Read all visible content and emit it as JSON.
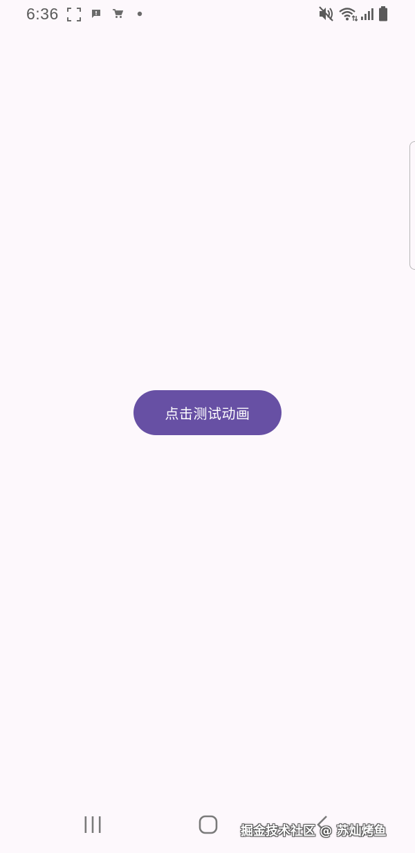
{
  "status_bar": {
    "time": "6:36",
    "left_icons": [
      "screenshot-frame-icon",
      "message-alert-icon",
      "shopping-cart-icon",
      "dot-icon"
    ],
    "right_icons": [
      "vibrate-mute-icon",
      "wifi-icon",
      "signal-icon",
      "battery-icon"
    ]
  },
  "main": {
    "button_label": "点击测试动画"
  },
  "nav_bar": {
    "items": [
      "recent-apps-icon",
      "home-icon",
      "back-icon"
    ]
  },
  "watermark": {
    "text": "掘金技术社区 @ 苏灿烤鱼"
  },
  "colors": {
    "background": "#fdf8fc",
    "button": "#6750a4",
    "button_text": "#ffffff",
    "status_text": "#5a5a5a"
  }
}
